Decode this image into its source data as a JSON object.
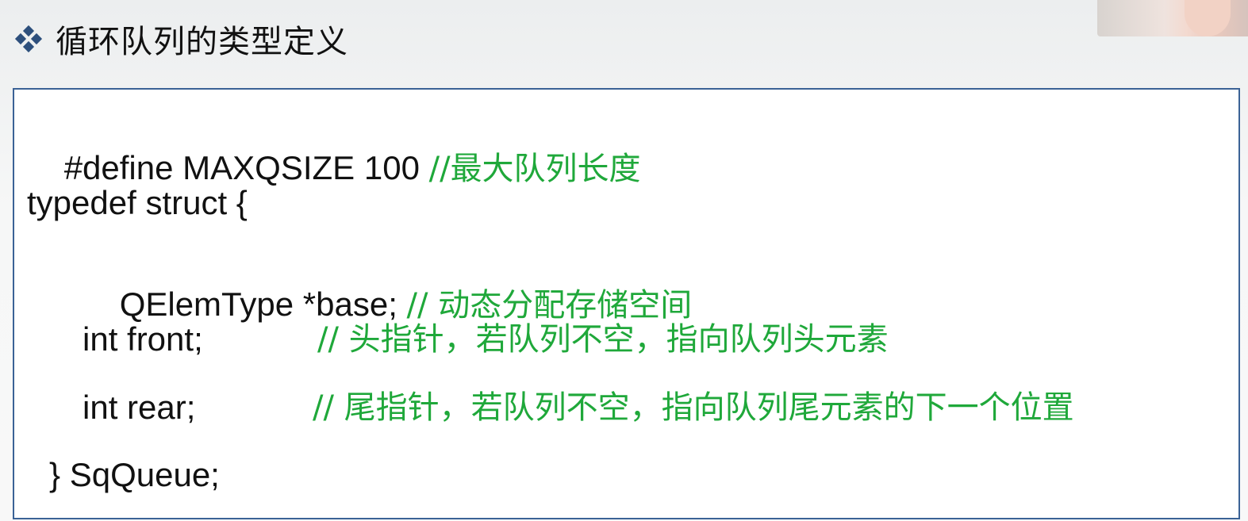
{
  "slide": {
    "title": "循环队列的类型定义",
    "bullet_icon": "diamond-cluster-icon",
    "colors": {
      "code_text": "#111111",
      "comment": "#1fa83a",
      "box_border": "#3b6296",
      "bullet": "#2d4f7c"
    }
  },
  "code": {
    "line1": {
      "code": "#define MAXQSIZE 100 ",
      "comment": "//最大队列长度"
    },
    "line2": {
      "code": "typedef struct {"
    },
    "line3": {
      "code": "QElemType *base; ",
      "comment": "// 动态分配存储空间"
    },
    "line4": {
      "code": "int front;",
      "comment": "// 头指针，若队列不空，指向队列头元素"
    },
    "line5": {
      "code": "int rear;",
      "comment": "// 尾指针，若队列不空，指向队列尾元素的下一个位置"
    },
    "line6": {
      "code": "} SqQueue;"
    }
  }
}
